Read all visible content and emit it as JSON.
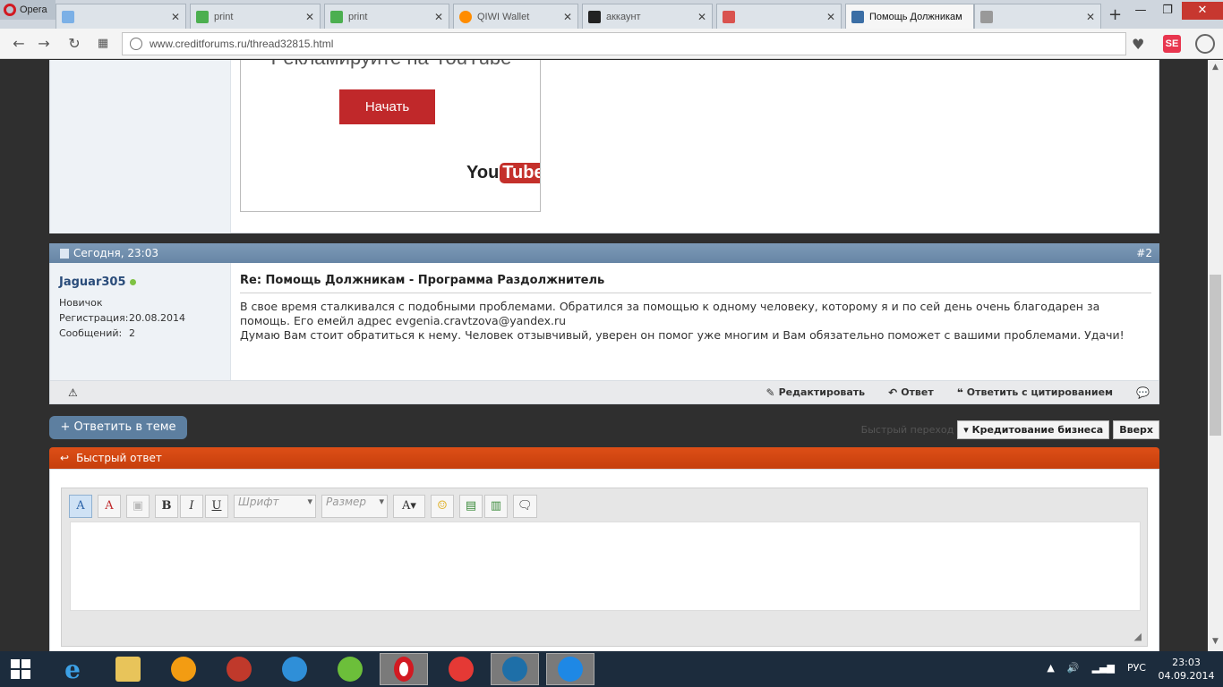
{
  "browser": {
    "opera_label": "Opera",
    "tabs": [
      {
        "title": "",
        "favicon_color": "#7bb0e6"
      },
      {
        "title": "print",
        "favicon_color": "#4caf50"
      },
      {
        "title": "print",
        "favicon_color": "#4caf50"
      },
      {
        "title": "QIWI Wallet",
        "favicon_color": "#ff8c00"
      },
      {
        "title": "аккаунт",
        "favicon_color": "#222222"
      },
      {
        "title": "",
        "favicon_color": "#d9534f"
      },
      {
        "title": "Помощь Должникам",
        "favicon_color": "#3b6ea5"
      },
      {
        "title": "",
        "favicon_color": "#999999"
      }
    ],
    "url": "www.creditforums.ru/thread32815.html",
    "extension_label": "SE"
  },
  "ad": {
    "headline": "Рекламируйте на YouTube",
    "button": "Начать",
    "logo_you": "You",
    "logo_tube": "Tube"
  },
  "post": {
    "date": "Сегодня, 23:03",
    "number": "#2",
    "username": "Jaguar305",
    "user_title": "Новичок",
    "reg_label": "Регистрация:",
    "reg_value": "20.08.2014",
    "posts_label": "Сообщений:",
    "posts_value": "2",
    "title": "Re: Помощь Должникам - Программа Раздолжнитель",
    "text_line1": "В свое время сталкивался с подобными проблемами. Обратился за помощью к одному человеку, которому я и по сей день очень благодарен за помощь. Его емейл адрес evgenia.cravtzova@yandex.ru",
    "text_line2": "Думаю Вам стоит обратиться к нему. Человек отзывчивый, уверен он помог уже многим и Вам обязательно поможет с вашими проблемами. Удачи!",
    "actions": {
      "edit": "Редактировать",
      "reply": "Ответ",
      "quote": "Ответить с цитированием"
    }
  },
  "thread_reply_button": "+ Ответить в теме",
  "quicknav": {
    "label": "Быстрый переход",
    "forum": "Кредитование бизнеса",
    "top": "Вверх"
  },
  "quick_reply": {
    "title": "Быстрый ответ",
    "font_placeholder": "Шрифт",
    "size_placeholder": "Размер"
  },
  "taskbar": {
    "lang": "РУС",
    "time": "23:03",
    "date": "04.09.2014"
  }
}
